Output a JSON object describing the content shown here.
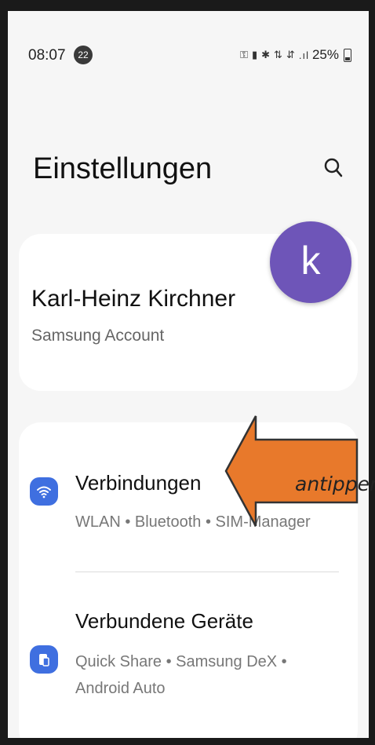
{
  "status_bar": {
    "time": "08:07",
    "notification_count": "22",
    "battery": "25%"
  },
  "header": {
    "title": "Einstellungen"
  },
  "account": {
    "name": "Karl-Heinz Kirchner",
    "subtitle": "Samsung Account",
    "avatar_letter": "k",
    "avatar_color": "#6e55b8"
  },
  "settings_items": [
    {
      "title": "Verbindungen",
      "subtitle": "WLAN • Bluetooth • SIM-Manager",
      "icon": "wifi-icon"
    },
    {
      "title": "Verbundene Geräte",
      "subtitle": "Quick Share • Samsung DeX • Android Auto",
      "icon": "connected-devices-icon"
    }
  ],
  "annotation": {
    "text": "antippen",
    "arrow_color": "#e8792b"
  },
  "colors": {
    "accent_blue": "#3f6fe0",
    "background": "#f6f6f6"
  }
}
